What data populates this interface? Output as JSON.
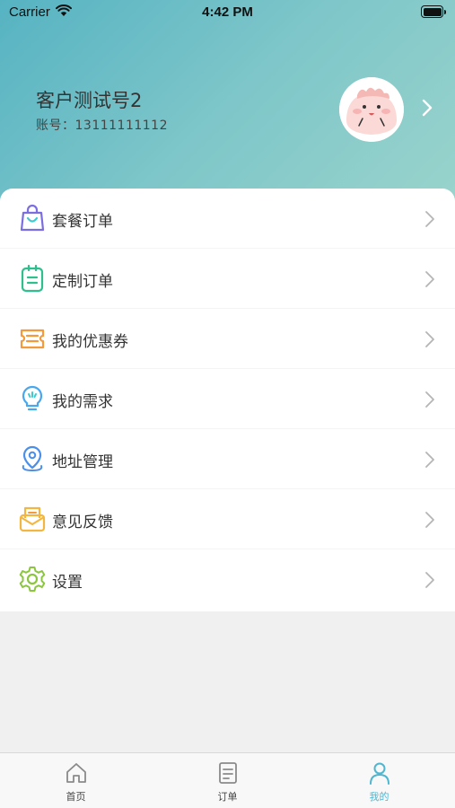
{
  "status_bar": {
    "carrier": "Carrier",
    "time": "4:42 PM"
  },
  "profile": {
    "name": "客户测试号2",
    "account": "账号：13111111112"
  },
  "menu": [
    {
      "label": "套餐订单",
      "icon": "shopping-bag-icon",
      "color": "#7b6fe0"
    },
    {
      "label": "定制订单",
      "icon": "clipboard-icon",
      "color": "#2fbf8e"
    },
    {
      "label": "我的优惠券",
      "icon": "coupon-icon",
      "color": "#f39a3b"
    },
    {
      "label": "我的需求",
      "icon": "lightbulb-icon",
      "color": "#4aa7ee"
    },
    {
      "label": "地址管理",
      "icon": "location-pin-icon",
      "color": "#4a8fea"
    },
    {
      "label": "意见反馈",
      "icon": "feedback-mail-icon",
      "color": "#f3b640"
    },
    {
      "label": "设置",
      "icon": "gear-icon",
      "color": "#8cc63f"
    }
  ],
  "tabbar": {
    "tabs": [
      {
        "label": "首页",
        "icon": "home-icon",
        "active": false
      },
      {
        "label": "订单",
        "icon": "order-list-icon",
        "active": false
      },
      {
        "label": "我的",
        "icon": "person-icon",
        "active": true
      }
    ],
    "active_color": "#4fb6d0"
  }
}
